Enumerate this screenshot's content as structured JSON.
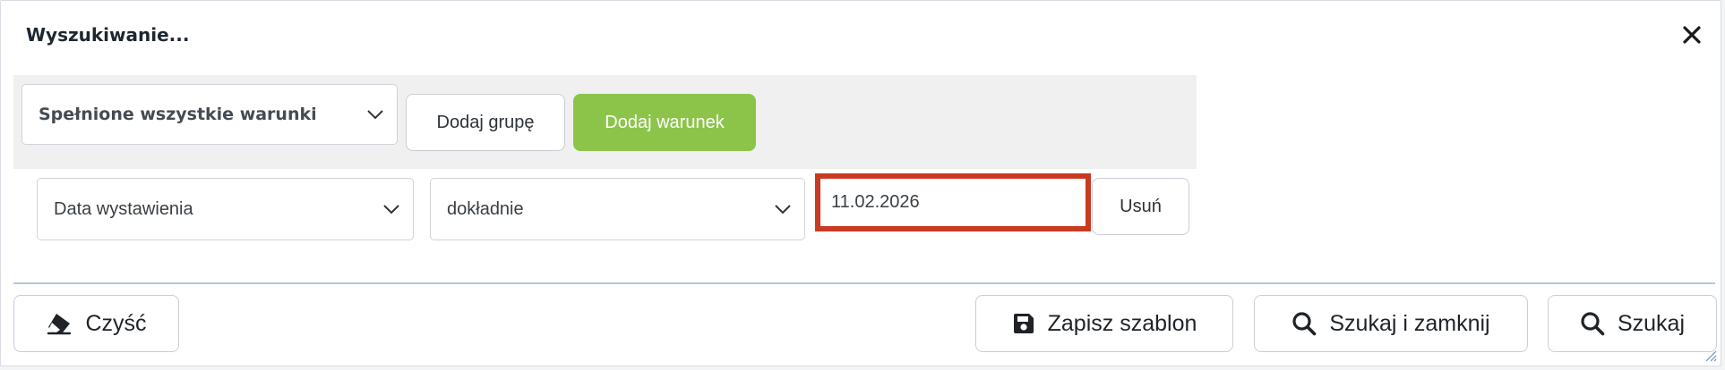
{
  "dialog": {
    "title": "Wyszukiwanie..."
  },
  "group": {
    "match_mode": "Spełnione wszystkie warunki",
    "add_group_label": "Dodaj grupę",
    "add_condition_label": "Dodaj warunek"
  },
  "condition": {
    "field": "Data wystawienia",
    "operator": "dokładnie",
    "value": "11.02.2026",
    "remove_label": "Usuń"
  },
  "footer": {
    "clear_label": "Czyść",
    "save_template_label": "Zapisz szablon",
    "search_close_label": "Szukaj i zamknij",
    "search_label": "Szukaj"
  },
  "colors": {
    "accent_green": "#8cc44a",
    "highlight_red": "#c83a22"
  },
  "icons": [
    "close-icon",
    "chevron-down-icon",
    "eraser-icon",
    "floppy-disk-icon",
    "search-icon"
  ]
}
